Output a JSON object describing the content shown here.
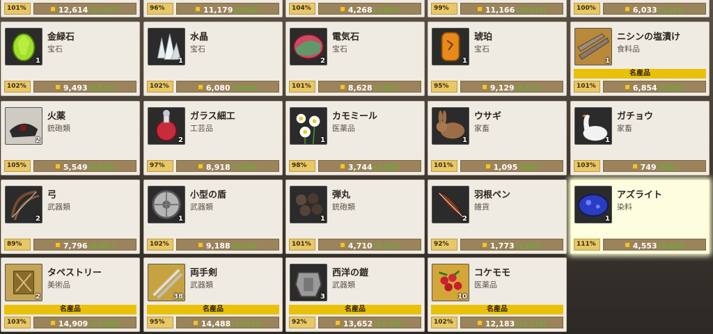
{
  "top_row": [
    {
      "pct": "101%",
      "price": "12,614",
      "orig": "(11,377)"
    },
    {
      "pct": "96%",
      "price": "11,179",
      "orig": "(9,502)"
    },
    {
      "pct": "104%",
      "price": "4,268",
      "orig": "(3,877)"
    },
    {
      "pct": "99%",
      "price": "11,166",
      "orig": "(10,037)"
    },
    {
      "pct": "100%",
      "price": "6,033",
      "orig": "(5,314)"
    }
  ],
  "items": [
    {
      "name": "金緑石",
      "category": "宝石",
      "qty": "1",
      "pct": "102%",
      "price": "9,493",
      "orig": "(8,629)",
      "specialty": "",
      "icon": "peridot-gem-icon",
      "color": "#8fd61f"
    },
    {
      "name": "水晶",
      "category": "宝石",
      "qty": "1",
      "pct": "102%",
      "price": "6,080",
      "orig": "(5,405)",
      "specialty": "",
      "icon": "crystal-icon",
      "color": "#d8dde2"
    },
    {
      "name": "電気石",
      "category": "宝石",
      "qty": "2",
      "pct": "101%",
      "price": "8,628",
      "orig": "(7,823)",
      "specialty": "",
      "icon": "tourmaline-gem-icon",
      "color": "#d0485f"
    },
    {
      "name": "琥珀",
      "category": "宝石",
      "qty": "1",
      "pct": "95%",
      "price": "9,129",
      "orig": "(8,153)",
      "specialty": "",
      "icon": "amber-icon",
      "color": "#e88a1a"
    },
    {
      "name": "ニシンの塩漬け",
      "category": "食料品",
      "qty": "1",
      "pct": "101%",
      "price": "6,854",
      "orig": "(6,249)",
      "specialty": "名産品",
      "icon": "salted-herring-icon",
      "color": "#8a7b6a"
    },
    {
      "name": "火薬",
      "category": "銃砲類",
      "qty": "2",
      "pct": "105%",
      "price": "5,549",
      "orig": "(4,928)",
      "specialty": "",
      "icon": "gunpowder-icon",
      "color": "#333333"
    },
    {
      "name": "ガラス細工",
      "category": "工芸品",
      "qty": "2",
      "pct": "97%",
      "price": "8,918",
      "orig": "(7,908)",
      "specialty": "",
      "icon": "glass-bottle-icon",
      "color": "#c62c3c"
    },
    {
      "name": "カモミール",
      "category": "医薬品",
      "qty": "1",
      "pct": "98%",
      "price": "3,744",
      "orig": "(3,289)",
      "specialty": "",
      "icon": "chamomile-icon",
      "color": "#f3f0d8"
    },
    {
      "name": "ウサギ",
      "category": "家畜",
      "qty": "1",
      "pct": "101%",
      "price": "1,095",
      "orig": "(946)",
      "specialty": "",
      "icon": "rabbit-icon",
      "color": "#9b6e45"
    },
    {
      "name": "ガチョウ",
      "category": "家畜",
      "qty": "1",
      "pct": "103%",
      "price": "749",
      "orig": "(646)",
      "specialty": "",
      "icon": "goose-icon",
      "color": "#f2f2f2"
    },
    {
      "name": "弓",
      "category": "武器類",
      "qty": "2",
      "pct": "89%",
      "price": "7,796",
      "orig": "(6,987)",
      "specialty": "",
      "icon": "bow-icon",
      "color": "#7a4a30"
    },
    {
      "name": "小型の盾",
      "category": "武器類",
      "qty": "1",
      "pct": "102%",
      "price": "9,188",
      "orig": "(8,206)",
      "specialty": "",
      "icon": "shield-icon",
      "color": "#a9a9a9"
    },
    {
      "name": "弾丸",
      "category": "銃砲類",
      "qty": "1",
      "pct": "101%",
      "price": "4,710",
      "orig": "(4,157)",
      "specialty": "",
      "icon": "bullets-icon",
      "color": "#4a3a30"
    },
    {
      "name": "羽根ペン",
      "category": "雑貨",
      "qty": "2",
      "pct": "92%",
      "price": "1,773",
      "orig": "(1,561)",
      "specialty": "",
      "icon": "quill-pen-icon",
      "color": "#7a3a20"
    },
    {
      "name": "アズライト",
      "category": "染料",
      "qty": "1",
      "pct": "111%",
      "price": "4,553",
      "orig": "(4,050)",
      "specialty": "",
      "icon": "azurite-icon",
      "color": "#2a3cc0"
    },
    {
      "name": "タペストリー",
      "category": "美術品",
      "qty": "2",
      "pct": "103%",
      "price": "14,909",
      "orig": "(13,588)",
      "specialty": "名産品",
      "icon": "tapestry-icon",
      "color": "#c4a456"
    },
    {
      "name": "両手剣",
      "category": "武器類",
      "qty": "38",
      "pct": "95%",
      "price": "14,488",
      "orig": "(13,333)",
      "specialty": "名産品",
      "icon": "two-handed-sword-icon",
      "color": "#c0c0c0"
    },
    {
      "name": "西洋の鎧",
      "category": "武器類",
      "qty": "3",
      "pct": "92%",
      "price": "13,652",
      "orig": "(12,307)",
      "specialty": "名産品",
      "icon": "armor-icon",
      "color": "#9a9a9a"
    },
    {
      "name": "コケモモ",
      "category": "医薬品",
      "qty": "10",
      "pct": "102%",
      "price": "12,183",
      "orig": "(11,118)",
      "specialty": "名産品",
      "icon": "lingonberry-icon",
      "color": "#c8202c"
    }
  ]
}
